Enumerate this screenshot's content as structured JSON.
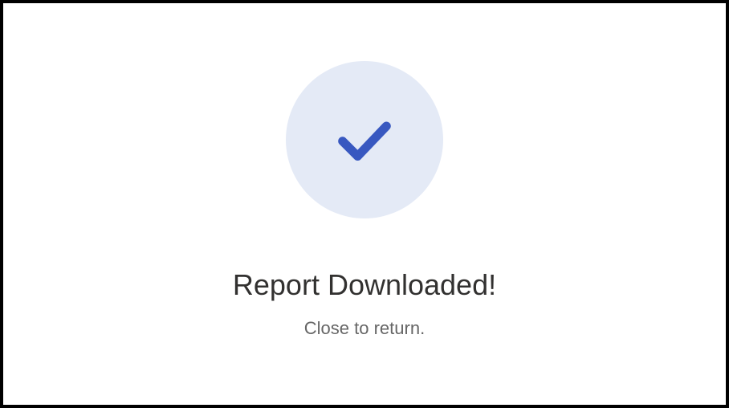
{
  "icon": {
    "name": "checkmark-icon",
    "circle_color": "#e4eaf6",
    "check_color": "#3858c0"
  },
  "title": "Report Downloaded!",
  "subtitle": "Close to return."
}
